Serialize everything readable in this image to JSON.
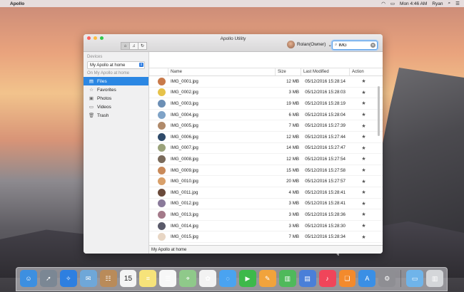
{
  "menubar": {
    "app_name": "Apollo",
    "clock": "Mon 4:46 AM",
    "user": "Ryan"
  },
  "window": {
    "title": "Apollo Utility",
    "user_label": "Rolan(Owner)",
    "search": {
      "value": "IMG",
      "placeholder": ""
    }
  },
  "sidebar": {
    "devices_header": "Devices",
    "selected_device": "My Apollo at home",
    "section_header": "On My Apollo at home",
    "items": [
      {
        "label": "Files",
        "icon": "doc-icon"
      },
      {
        "label": "Favorites",
        "icon": "star-icon"
      },
      {
        "label": "Photos",
        "icon": "photo-icon"
      },
      {
        "label": "Videos",
        "icon": "video-icon"
      },
      {
        "label": "Trash",
        "icon": "trash-icon"
      }
    ]
  },
  "table": {
    "columns": [
      "Name",
      "Size",
      "Last Modified",
      "Action"
    ],
    "rows": [
      {
        "name": "IMG_0001.jpg",
        "size": "12 MB",
        "modified": "05/12/2016 15:28:14",
        "thumb": "#c97a4a"
      },
      {
        "name": "IMG_0002.jpg",
        "size": "3 MB",
        "modified": "05/12/2016 15:28:03",
        "thumb": "#e6c24a"
      },
      {
        "name": "IMG_0003.jpg",
        "size": "19 MB",
        "modified": "05/12/2016 15:28:19",
        "thumb": "#6c8fb5"
      },
      {
        "name": "IMG_0004.jpg",
        "size": "6 MB",
        "modified": "05/12/2016 15:28:04",
        "thumb": "#7fa3c7"
      },
      {
        "name": "IMG_0005.jpg",
        "size": "7 MB",
        "modified": "05/12/2016 15:27:39",
        "thumb": "#b08a6a"
      },
      {
        "name": "IMG_0006.jpg",
        "size": "12 MB",
        "modified": "05/12/2016 15:27:44",
        "thumb": "#2f4b6a"
      },
      {
        "name": "IMG_0007.jpg",
        "size": "14 MB",
        "modified": "05/12/2016 15:27:47",
        "thumb": "#9aa27a"
      },
      {
        "name": "IMG_0008.jpg",
        "size": "12 MB",
        "modified": "05/12/2016 15:27:54",
        "thumb": "#7a6a5a"
      },
      {
        "name": "IMG_0009.jpg",
        "size": "15 MB",
        "modified": "05/12/2016 15:27:58",
        "thumb": "#c98a5a"
      },
      {
        "name": "IMG_0010.jpg",
        "size": "20 MB",
        "modified": "05/12/2016 15:27:57",
        "thumb": "#d9a06a"
      },
      {
        "name": "IMG_0011.jpg",
        "size": "4 MB",
        "modified": "05/12/2016 15:28:41",
        "thumb": "#6a4a3a"
      },
      {
        "name": "IMG_0012.jpg",
        "size": "3 MB",
        "modified": "05/12/2016 15:28:41",
        "thumb": "#8a7a9a"
      },
      {
        "name": "IMG_0013.jpg",
        "size": "3 MB",
        "modified": "05/12/2016 15:28:36",
        "thumb": "#a47a8a"
      },
      {
        "name": "IMG_0014.jpg",
        "size": "3 MB",
        "modified": "05/12/2016 15:28:30",
        "thumb": "#5a5a6a"
      },
      {
        "name": "IMG_0015.jpg",
        "size": "7 MB",
        "modified": "05/12/2016 15:28:34",
        "thumb": "#e8d6c4"
      }
    ]
  },
  "statusbar": {
    "text": "My Apollo at home"
  },
  "dock": {
    "calendar_day": "15",
    "items": [
      {
        "name": "finder",
        "color": "#3d8fe0",
        "glyph": "☺"
      },
      {
        "name": "launchpad",
        "color": "#7b8794",
        "glyph": "➚"
      },
      {
        "name": "safari",
        "color": "#2e7fe0",
        "glyph": "✧"
      },
      {
        "name": "mail",
        "color": "#6fa7d8",
        "glyph": "✉"
      },
      {
        "name": "contacts",
        "color": "#b98b5a",
        "glyph": "☷"
      },
      {
        "name": "calendar",
        "color": "#f4f4f4",
        "glyph": ""
      },
      {
        "name": "notes",
        "color": "#f6e37a",
        "glyph": "≡"
      },
      {
        "name": "reminders",
        "color": "#f7f7f7",
        "glyph": "☰"
      },
      {
        "name": "maps",
        "color": "#8fc98a",
        "glyph": "⌖"
      },
      {
        "name": "photos",
        "color": "#f2f2f2",
        "glyph": "✿"
      },
      {
        "name": "messages",
        "color": "#4aa3f0",
        "glyph": "◌"
      },
      {
        "name": "facetime",
        "color": "#3db94a",
        "glyph": "▶"
      },
      {
        "name": "pages",
        "color": "#f1a33c",
        "glyph": "✎"
      },
      {
        "name": "numbers",
        "color": "#4fb95b",
        "glyph": "▥"
      },
      {
        "name": "keynote",
        "color": "#4a7fd8",
        "glyph": "▤"
      },
      {
        "name": "music",
        "color": "#f0455a",
        "glyph": "♪"
      },
      {
        "name": "ibooks",
        "color": "#f38a2c",
        "glyph": "❏"
      },
      {
        "name": "app-store",
        "color": "#3a8fe5",
        "glyph": "A"
      },
      {
        "name": "system-preferences",
        "color": "#8e8e93",
        "glyph": "⚙"
      },
      {
        "name": "downloads-folder",
        "color": "#6fb4ea",
        "glyph": "▭"
      },
      {
        "name": "trash",
        "color": "#d4d6d9",
        "glyph": "▥"
      }
    ]
  }
}
